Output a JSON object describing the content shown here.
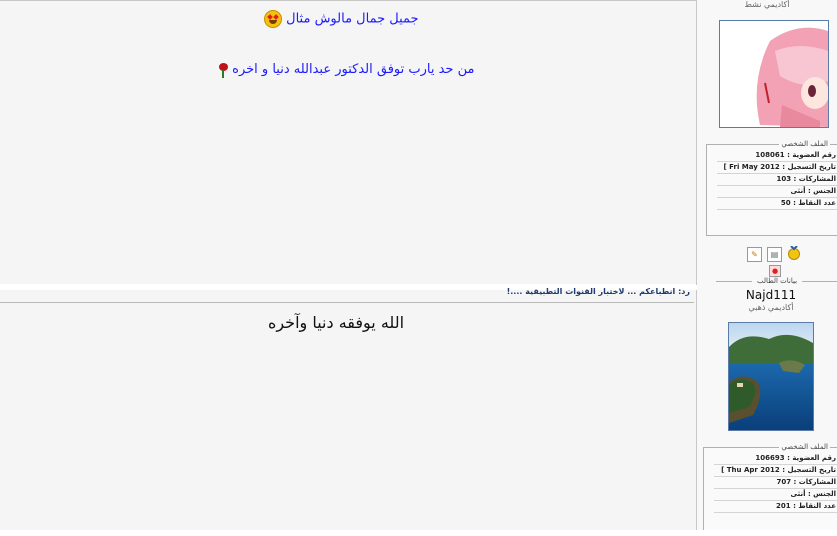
{
  "post1": {
    "line1": "جميل جمال مالوش مثال",
    "line2": "من حد يارب توفق الدكتور عبدالله دنيا و اخره"
  },
  "post2": {
    "title": "رد: انطباعكم ... لاختبار القنوات التطبيقية ....!",
    "body": "الله يوفقه دنيا وآخره"
  },
  "user1": {
    "rank": "أكاديمي نشط",
    "profile_legend": "الملف الشخصي",
    "rows": [
      {
        "label": "رقم العضوية :",
        "value": "108061"
      },
      {
        "label": "تاريخ التسجيل :",
        "value": "Fri May 2012 ]"
      },
      {
        "label": "المشاركات :",
        "value": "103"
      },
      {
        "label": "الجنس :",
        "value": "أنثى"
      },
      {
        "label": "عدد النقاط :",
        "value": "50"
      }
    ],
    "student_legend": "بيانات الطالب"
  },
  "user2": {
    "username": "Najd111",
    "rank": "أكاديمي ذهبي",
    "profile_legend": "الملف الشخصي",
    "rows": [
      {
        "label": "رقم العضوية :",
        "value": "106693"
      },
      {
        "label": "تاريخ التسجيل :",
        "value": "Thu Apr 2012 ]"
      },
      {
        "label": "المشاركات :",
        "value": "707"
      },
      {
        "label": "الجنس :",
        "value": "أنثى"
      },
      {
        "label": "عدد النقاط :",
        "value": "201"
      }
    ]
  },
  "icons": [
    "smiling-face-heart-eyes",
    "rose",
    "medal",
    "pencil-badge",
    "note-badge",
    "record-badge"
  ],
  "colors": {
    "link_blue": "#1a1aff",
    "title_navy": "#1f3a6e",
    "avatar_border": "#5a7aa8"
  }
}
